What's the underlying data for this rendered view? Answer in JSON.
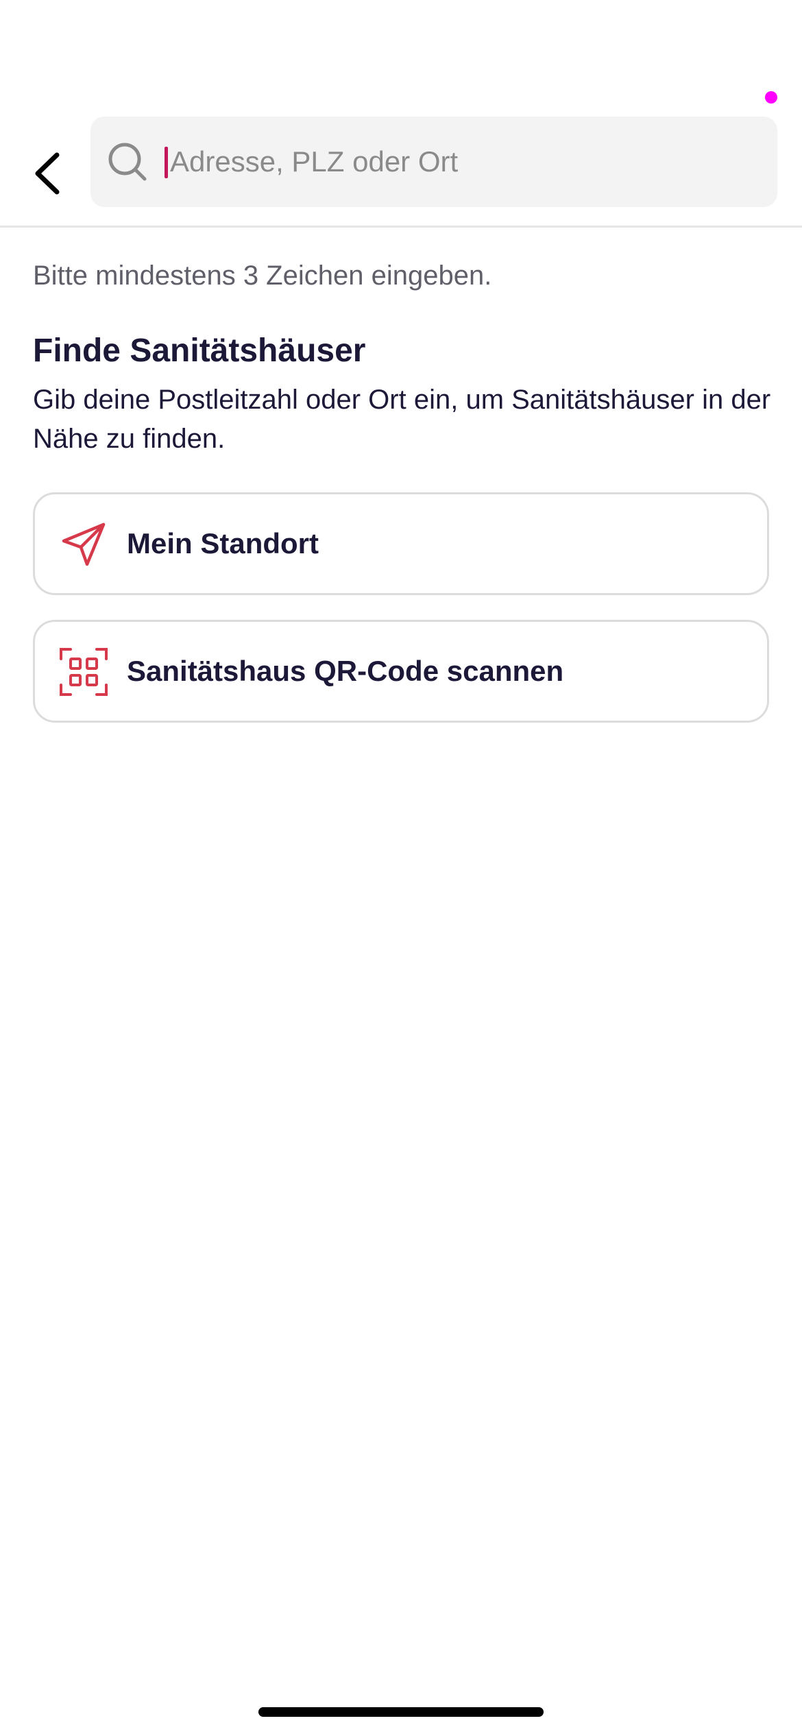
{
  "search": {
    "placeholder": "Adresse, PLZ oder Ort",
    "value": ""
  },
  "hint": "Bitte mindestens 3 Zeichen eingeben.",
  "section": {
    "title": "Finde Sanitätshäuser",
    "description": "Gib deine Postleitzahl oder Ort ein, um Sanitätshäuser in der Nähe zu finden."
  },
  "options": [
    {
      "label": "Mein Standort",
      "icon": "navigation-arrow-icon"
    },
    {
      "label": "Sanitätshaus QR-Code scannen",
      "icon": "qr-scan-icon"
    }
  ],
  "colors": {
    "accent": "#d63a4a",
    "text": "#1b1838",
    "caret": "#c2185b",
    "privacy_indicator": "#ff00ff"
  }
}
